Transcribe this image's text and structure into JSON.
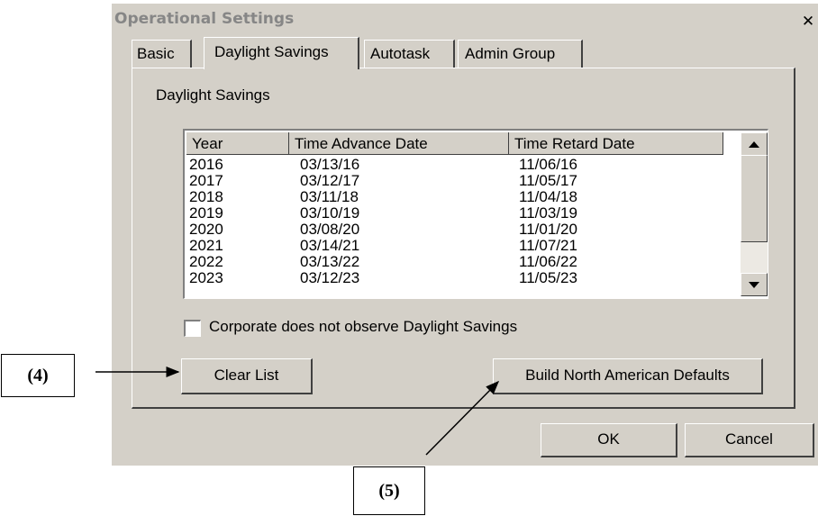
{
  "window": {
    "title": "Operational Settings",
    "close_glyph": "✕"
  },
  "tabs": [
    {
      "label": "Basic"
    },
    {
      "label": "Daylight Savings",
      "active": true
    },
    {
      "label": "Autotask"
    },
    {
      "label": "Admin Group"
    }
  ],
  "group_label": "Daylight Savings",
  "list": {
    "columns": [
      "Year",
      "Time Advance Date",
      "Time Retard Date"
    ],
    "rows": [
      [
        "2016",
        "03/13/16",
        "11/06/16"
      ],
      [
        "2017",
        "03/12/17",
        "11/05/17"
      ],
      [
        "2018",
        "03/11/18",
        "11/04/18"
      ],
      [
        "2019",
        "03/10/19",
        "11/03/19"
      ],
      [
        "2020",
        "03/08/20",
        "11/01/20"
      ],
      [
        "2021",
        "03/14/21",
        "11/07/21"
      ],
      [
        "2022",
        "03/13/22",
        "11/06/22"
      ],
      [
        "2023",
        "03/12/23",
        "11/05/23"
      ]
    ]
  },
  "checkbox": {
    "label": "Corporate does not observe Daylight Savings",
    "checked": false
  },
  "buttons": {
    "clear_list": "Clear List",
    "build_defaults": "Build North American Defaults",
    "ok": "OK",
    "cancel": "Cancel"
  },
  "annotations": {
    "callout_4": "(4)",
    "callout_5": "(5)"
  }
}
